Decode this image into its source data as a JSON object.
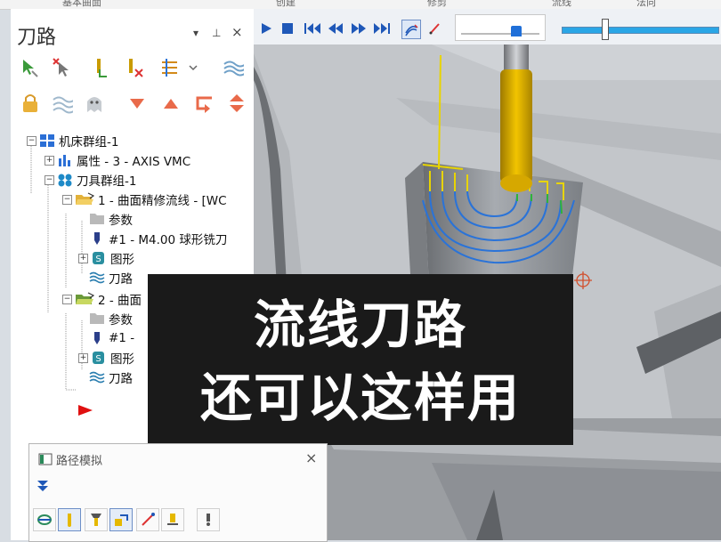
{
  "ribbon": {
    "tabs": [
      "基本曲面",
      "创建",
      "修剪",
      "流线",
      "法向"
    ]
  },
  "panel": {
    "title": "刀路",
    "controls": {
      "dropdown": "▾",
      "pin": "⊥",
      "close": "×"
    },
    "toolbar_row1": [
      "select-all-icon",
      "select-failed-icon",
      "regen-all-icon",
      "regen-dirty-icon",
      "toggle-display-icon",
      "toolpath-display-icon"
    ],
    "toolbar_row2": [
      "lock-icon",
      "toggle-paths-icon",
      "ghost-icon",
      "move-down-icon",
      "move-up-icon",
      "insert-arrow-icon",
      "expand-icon"
    ]
  },
  "tree": {
    "machine_group": "机床群组-1",
    "properties": "属性 - 3 - AXIS VMC",
    "toolgroup": "刀具群组-1",
    "op1": "1 - 曲面精修流线 - [WC",
    "op1_params": "参数",
    "op1_tool": "#1 - M4.00 球形铣刀",
    "op1_geom": "图形",
    "op1_path": "刀路",
    "op2": "2 - 曲面",
    "op2_params": "参数",
    "op2_tool": "#1 -",
    "op2_geom": "图形",
    "op2_path": "刀路"
  },
  "caption": {
    "line1": "流线刀路",
    "line2": "还可以这样用"
  },
  "dialog": {
    "title": "路径模拟",
    "close": "×"
  },
  "colors": {
    "path_yellow": "#e8d400",
    "path_blue": "#2a73d8",
    "path_green": "#2fb33a",
    "tool_yellow": "#e5b800",
    "caption_bg": "#1a1a1a"
  }
}
